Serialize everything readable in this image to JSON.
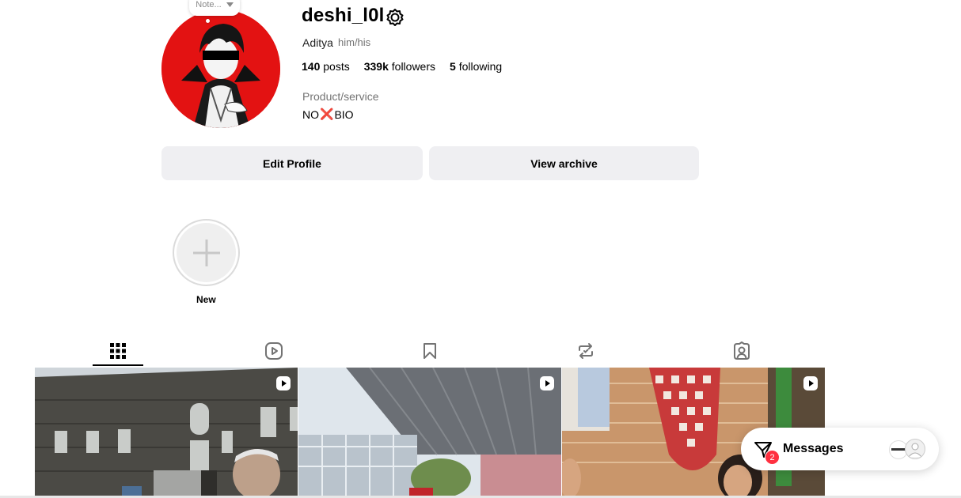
{
  "profile": {
    "note_label": "Note...",
    "username": "deshi_l0l",
    "full_name": "Aditya",
    "pronouns": "him/his",
    "stats": {
      "posts_count": "140",
      "posts_label": "posts",
      "followers_count": "339k",
      "followers_label": "followers",
      "following_count": "5",
      "following_label": "following"
    },
    "category": "Product/service",
    "bio_prefix": "NO",
    "bio_emoji": "❌",
    "bio_suffix": "BIO"
  },
  "actions": {
    "edit_label": "Edit Profile",
    "archive_label": "View archive"
  },
  "highlights": {
    "new_label": "New"
  },
  "tabs": [
    {
      "name": "posts-grid-icon",
      "active": true
    },
    {
      "name": "reels-icon",
      "active": false
    },
    {
      "name": "saved-icon",
      "active": false
    },
    {
      "name": "reposts-icon",
      "active": false
    },
    {
      "name": "tagged-icon",
      "active": false
    }
  ],
  "messages": {
    "label": "Messages",
    "badge": "2"
  }
}
